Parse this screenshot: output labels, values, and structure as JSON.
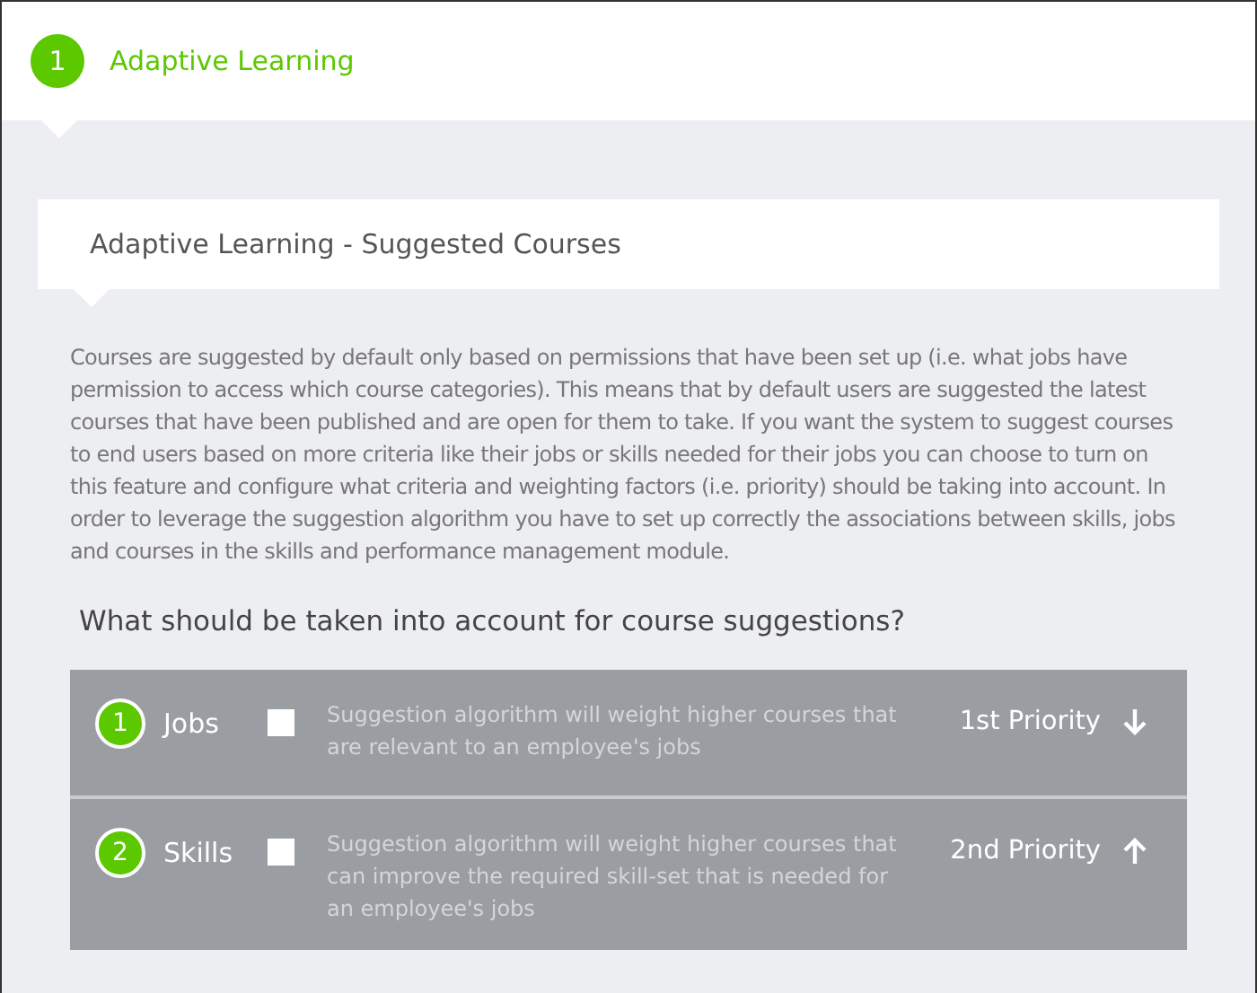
{
  "step": {
    "number": "1",
    "title": "Adaptive Learning"
  },
  "card": {
    "title": "Adaptive Learning - Suggested Courses"
  },
  "description": "Courses are suggested by default only based on permissions that have been set up (i.e. what jobs have permission to access which course categories). This means that by default users are suggested the latest courses that have been published and are open for them to take. If you want the system to suggest courses to end users based on more criteria like their jobs or skills needed for their jobs you can choose to turn on this feature and configure what criteria and weighting factors (i.e. priority) should be taking into account. In order to leverage the suggestion algorithm you have to set up correctly the associations between skills, jobs and courses in the skills and performance management module.",
  "question": "What should be taken into account for course suggestions?",
  "criteria": [
    {
      "number": "1",
      "label": "Jobs",
      "checked": false,
      "description": "Suggestion algorithm will weight higher courses that are relevant to an employee's jobs",
      "priority": "1st Priority",
      "kind": "down"
    },
    {
      "number": "2",
      "label": "Skills",
      "checked": false,
      "description": "Suggestion algorithm will weight higher courses that can improve the required skill-set that is needed for an employee's jobs",
      "priority": "2nd Priority",
      "kind": "up"
    }
  ]
}
